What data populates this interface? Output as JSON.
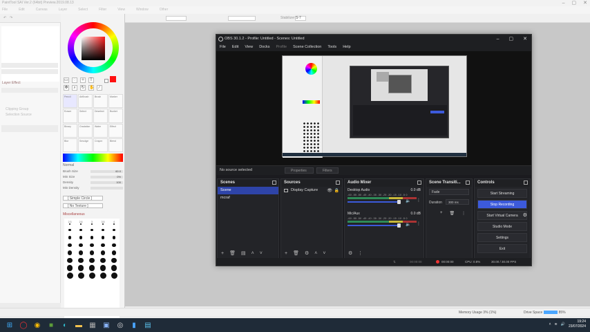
{
  "sai": {
    "title": "PaintTool SAI Ver.2 (64bit) Preview.2019.08.13",
    "menu": [
      "File",
      "Edit",
      "Canvas",
      "Layer",
      "Select",
      "Filter",
      "View",
      "Window",
      "Other"
    ],
    "toolbar": {
      "stabilizer_label": "Stabilizer",
      "stabilizer_value": "S-7"
    },
    "layer_panel": {
      "layer_effect": "Layer Effect",
      "clipping_group": "Clipping Group",
      "selection_source": "Selection Source"
    },
    "brush_mode": "Normal",
    "params": [
      {
        "label": "Brush Size",
        "value": "60.0"
      },
      {
        "label": "Min Size",
        "value": "0%"
      },
      {
        "label": "Density",
        "value": "100"
      },
      {
        "label": "Min Density",
        "value": ""
      }
    ],
    "shape_dropdown": "[ Simple Circle ]",
    "texture_dropdown": "[ No Texture ]",
    "misc_label": "Miscellaneous",
    "brushes": [
      "Pencil",
      "AirBrush",
      "Brush",
      "Marker",
      "Eraser",
      "Select",
      "Deselect",
      "Bucket",
      "Binary",
      "Gradation",
      "Water",
      "Effect",
      "Blur",
      "Smudge",
      "Crayon",
      "Blend"
    ],
    "dot_sizes": [
      [
        "2.3",
        "2.6",
        "3",
        "3.5",
        "4"
      ],
      [
        "5",
        "6",
        "7",
        "8",
        "9"
      ],
      [
        "10",
        "12",
        "14",
        "16",
        "20"
      ],
      [
        "25",
        "30",
        "35",
        "40",
        "50"
      ],
      [
        "60",
        "70",
        "80",
        "100",
        "120"
      ],
      [
        "160",
        "200",
        "250",
        "300",
        "350"
      ],
      [
        "400",
        "450",
        "500",
        "600",
        "700"
      ],
      [
        "800",
        "1000",
        "1200",
        "1500",
        "2000"
      ]
    ],
    "status": {
      "memory_label": "Memory Usage",
      "memory_value": "3% (1%)",
      "drive_label": "Drive Space",
      "drive_value": "85%"
    }
  },
  "obs": {
    "title": "OBS 30.1.2 - Profile: Untitled - Scenes: Untitled",
    "menu": [
      "File",
      "Edit",
      "View",
      "Docks",
      "Profile",
      "Scene Collection",
      "Tools",
      "Help"
    ],
    "no_source": "No source selected",
    "properties_btn": "Properties",
    "filters_btn": "Filters",
    "docks": {
      "scenes": {
        "title": "Scenes",
        "items": [
          "Scene",
          "mcraf"
        ]
      },
      "sources": {
        "title": "Sources",
        "items": [
          "Display Capture"
        ]
      },
      "mixer": {
        "title": "Audio Mixer",
        "channels": [
          {
            "name": "Desktop Audio",
            "db": "0.0 dB"
          },
          {
            "name": "Mic/Aux",
            "db": "0.0 dB"
          }
        ],
        "scale": "-60 -55 -50 -45 -40 -35 -30 -25 -20 -15 -10 -5 0"
      },
      "transitions": {
        "title": "Scene Transiti...",
        "selected": "Fade",
        "duration_label": "Duration",
        "duration_value": "300 ms"
      },
      "controls": {
        "title": "Controls",
        "buttons": [
          "Start Streaming",
          "Stop Recording",
          "Start Virtual Camera",
          "Studio Mode",
          "Settings",
          "Exit"
        ]
      }
    },
    "status": {
      "stream_time": "00:00:00",
      "rec_time": "00:00:00",
      "cpu": "CPU: 0.8%",
      "fps": "30.00 / 30.00 FPS"
    }
  },
  "taskbar": {
    "time": "19:24",
    "date": "23/07/2024"
  },
  "colors": {
    "obs_accent": "#3c5adb",
    "sai_red": "#ff1010",
    "taskbar": "#1f2b38"
  }
}
